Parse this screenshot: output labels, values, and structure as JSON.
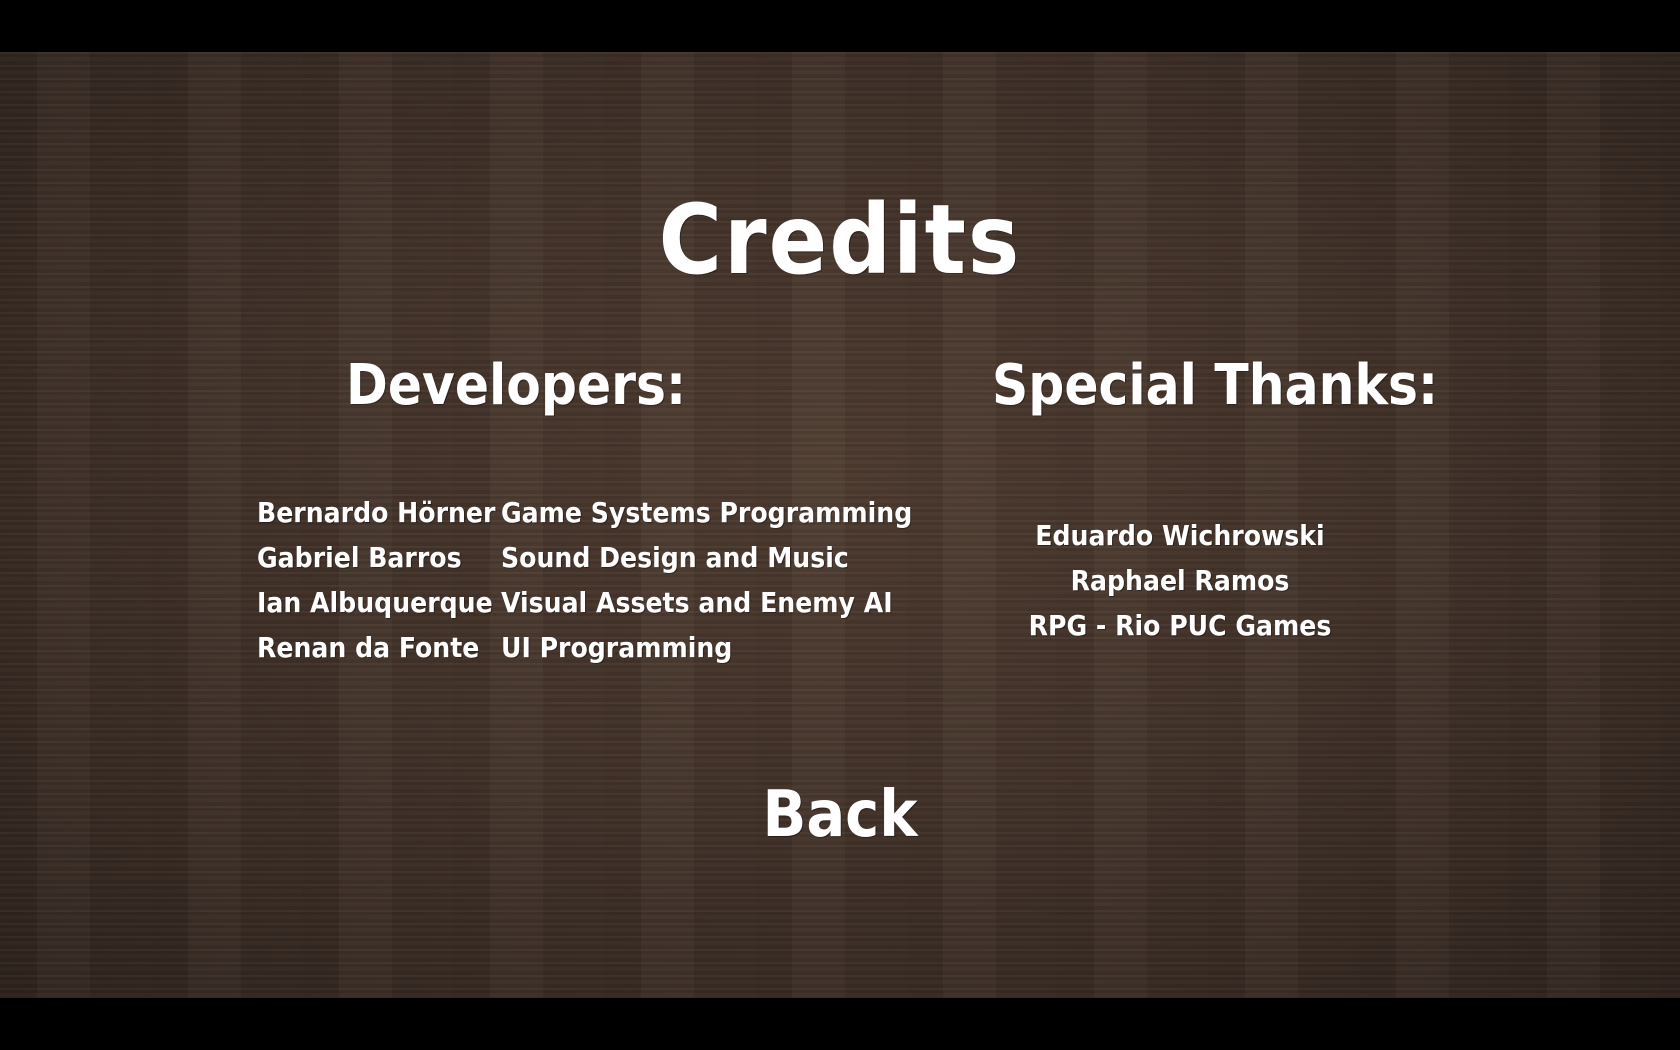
{
  "screen": {
    "title": "Credits",
    "background_color": "#43332a",
    "text_color": "#ffffff"
  },
  "developers": {
    "heading": "Developers:",
    "members": [
      {
        "name": "Bernardo Hörner",
        "role": "Game Systems Programming"
      },
      {
        "name": "Gabriel Barros",
        "role": "Sound Design and Music"
      },
      {
        "name": "Ian Albuquerque",
        "role": "Visual Assets and Enemy AI"
      },
      {
        "name": "Renan da Fonte",
        "role": "UI Programming"
      }
    ]
  },
  "special_thanks": {
    "heading": "Special Thanks:",
    "people": [
      "Eduardo Wichrowski",
      "Raphael Ramos",
      "RPG - Rio PUC Games"
    ]
  },
  "back_button": {
    "label": "Back"
  }
}
